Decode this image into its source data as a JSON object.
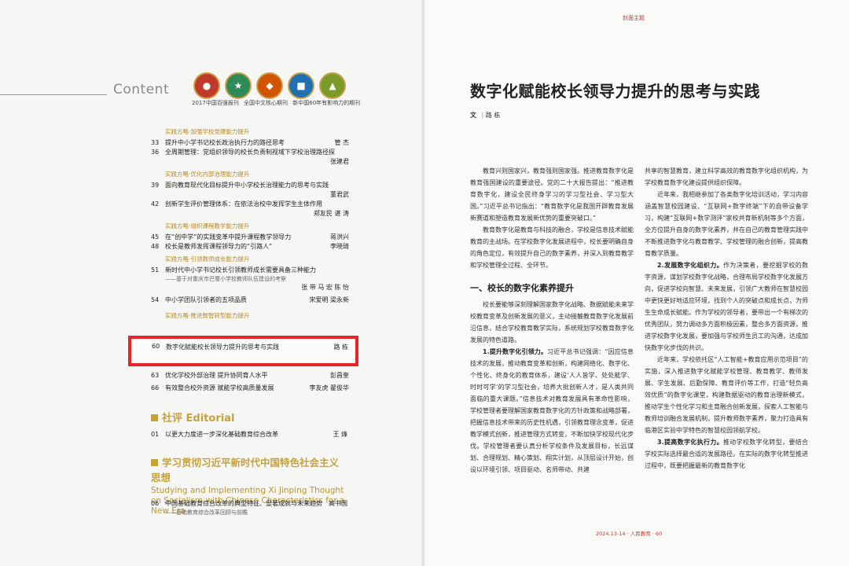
{
  "left": {
    "content_heading": "Content",
    "logo_caption": "2017中国百强报刊  全国中文核心期刊  新中国60年有影响力的期刊",
    "sections": [
      {
        "header": "实践方略·加强学校党建能力提升",
        "entries": [
          {
            "page": "33",
            "title": "提升中小学书记校长政治执行力的路径思考",
            "author": "管 杰"
          },
          {
            "page": "36",
            "title": "全周期管理：党组织领导的校长负责制视域下学校治理路径探",
            "author": "张建君"
          }
        ]
      },
      {
        "header": "实践方略·优化内部治理能力提升",
        "entries": [
          {
            "page": "39",
            "title": "面向教育现代化目标提升中小学校长治理能力的思考与实践",
            "author": "董君武"
          },
          {
            "page": "42",
            "title": "创新学生评价管理体系：在依法治校中发挥学生主体作用",
            "author": "郑友民 谌 涛"
          }
        ]
      },
      {
        "header": "实践方略·组织课程教学能力提升",
        "entries": [
          {
            "page": "45",
            "title": "在“创中学”的实践变革中提升课程教学领导力",
            "author": "蒋洪兴"
          },
          {
            "page": "48",
            "title": "校长是教师发挥课程领导力的“引路人”",
            "author": "李晓琦"
          }
        ]
      },
      {
        "header": "实践方略·引领教师成长能力提升",
        "entries": [
          {
            "page": "51",
            "title": "新时代中小学书记校长引领教师成长需要具备三种能力",
            "subtitle": "——基于对重庆市巴蜀小学校教师队伍建设的考察",
            "author": "张 带 马 宏 陈 怡"
          },
          {
            "page": "54",
            "title": "中小学团队引领者的五项品质",
            "author": "宋爱明 梁永新"
          }
        ]
      },
      {
        "header": "实践方略·推进数智转型能力提升",
        "entries": []
      }
    ],
    "highlight_entry": {
      "page": "60",
      "title": "数字化赋能校长领导力提升的思考与实践",
      "author": "路 栋"
    },
    "after_entries": [
      {
        "page": "63",
        "title": "优化学校外部治理  提升协同育人水平",
        "author": "彭昌奎"
      },
      {
        "page": "66",
        "title": "有效整合校外资源  赋能学校高质量发展",
        "author": "李友虎 翟俊华"
      }
    ],
    "editorial_heading": "社评  Editorial",
    "editorial_entry": {
      "page": "01",
      "title": "以更大力度进一步深化基础教育综合改革",
      "author": "王 烽"
    },
    "big_heading_cn": "学习贯彻习近平新时代中国特色社会主义思想",
    "big_heading_en": "Studying and Implementing Xi Jinping Thought on Socialism with Chinese Characteristics for a New Era",
    "last_entry": {
      "page": "06",
      "title": "中国基础教育综合改革的典型特征、显著成就与未来趋势",
      "subtitle": "——基础教育综合改革回顾与前瞻",
      "author": "高书国"
    },
    "logo_colors": [
      "#c0392b",
      "#2e8b57",
      "#d35400",
      "#1f6fb2",
      "#7a9a2a"
    ]
  },
  "right": {
    "cover_topic": "封面主题",
    "title": "数字化赋能校长领导力提升的思考与实践",
    "byline_prefix": "文",
    "byline_name": "路 栋",
    "col1_p1": "教育兴则国家兴，教育强则国家强。推进教育数字化是教育强国建设的重要途径。党的二十大报告提出：“推进教育数字化，建设全民终身学习的学习型社会、学习型大国。”习近平总书记指出：“教育数字化是我国开辟教育发展新赛道和塑造教育发展新优势的重要突破口。”",
    "col1_p2": "教育数字化是教育与科技的融合，学校是信息技术赋能教育的主战场。在学校数字化发展进程中，校长要明确自身的角色定位，有效提升自己的数字素养，并深入到教育教学和学校管理全过程、全环节。",
    "col1_h1": "一、校长的数字化素养提升",
    "col1_p3": "校长要能够深刻理解国家数字化战略、数据赋能未来学校教育变革及创新发展的意义，主动接触教育数字化发展前沿信息，结合学校教育教学实际，系统规划学校教育数字化发展的特色道路。",
    "col1_p4_bold": "1.提升数字化引领力。",
    "col1_p4": "习近平总书记强调：“因应信息技术的发展，推动教育变革和创新，构建网络化、数字化、个性化、终身化的教育体系，建设‘人人皆学、处处能学、时时可学’的学习型社会，培养大批创新人才，是人类共同面临的重大课题。”信息技术对教育发展具有革命性影响，学校管理者要理解国家教育数字化的方针政策和战略部署，把握信息技术带来的历史性机遇，引领教育理念变革，促进教学模式创新，推进管理方式转变，不断加快学校现代化步伐。学校管理者要认真分析学校条件及发展目标，长远谋划、合理规划、精心策划、翔实计划，从顶层设计开始，创设以环境引领、项目驱动、名师带动、共建",
    "col2_p1": "共享的智慧教育，建立科学高效的教育数字化组织机构，为学校教育数字化建设提供组织保障。",
    "col2_p2": "近年来，我相继参加了各类数字化培训活动，学习内容涵盖智慧校园建设、“互联网+数字终端”下的自带设备学习，构建“互联网+数学测评”家校共育新机制等多个方面，全方位提升自身的数字化素养，并在自己的教育管理实践中不断推进数字化与教育教学、学校管理的融合创新，提高教育教学质量。",
    "col2_p3_bold": "2.发展数字化组织力。",
    "col2_p3": "作为决策者，要挖掘学校的数字资源，谋划学校数字化战略，合理布局学校数字化发展方向，促进学校向智慧、未来发展，引领广大教师在智慧校园中更快更好地适应环境，找到个人的突破点和成长点，为师生生命成长赋能。作为学校的领导者，要带出一个有梯次的优秀团队，努力调动多方面积极因素，整合多方面资源，推进学校数字化发展，要加强与学校师生员工的沟通，达成加快数字化步伐的共识。",
    "col2_p4": "近年来，学校依托区“人工智能+教育应用示范项目”的实施，深入推进数字化赋能学校管理、教育教学、教师发展、学生发展、后勤保障、教育评价等工作，打造“轻负高效优质”的数字化课堂，构建数据驱动的教育治理新模式，推动学生个性化学习和主育融合创新发展，探索人工智能与教师培训融合发展机制，提升教师数字素养，聚力打造具有临港区实验中学特色的智慧校园领航学校。",
    "col2_p5_bold": "3.提高数字化执行力。",
    "col2_p5": "推动学校数字化转型，要结合学校实际选择最合适的发展路径。在实际的数字化转型推进过程中，既要把握最新的教育数字化",
    "footer": "2024.13-14 · 人民教育 · 60"
  }
}
